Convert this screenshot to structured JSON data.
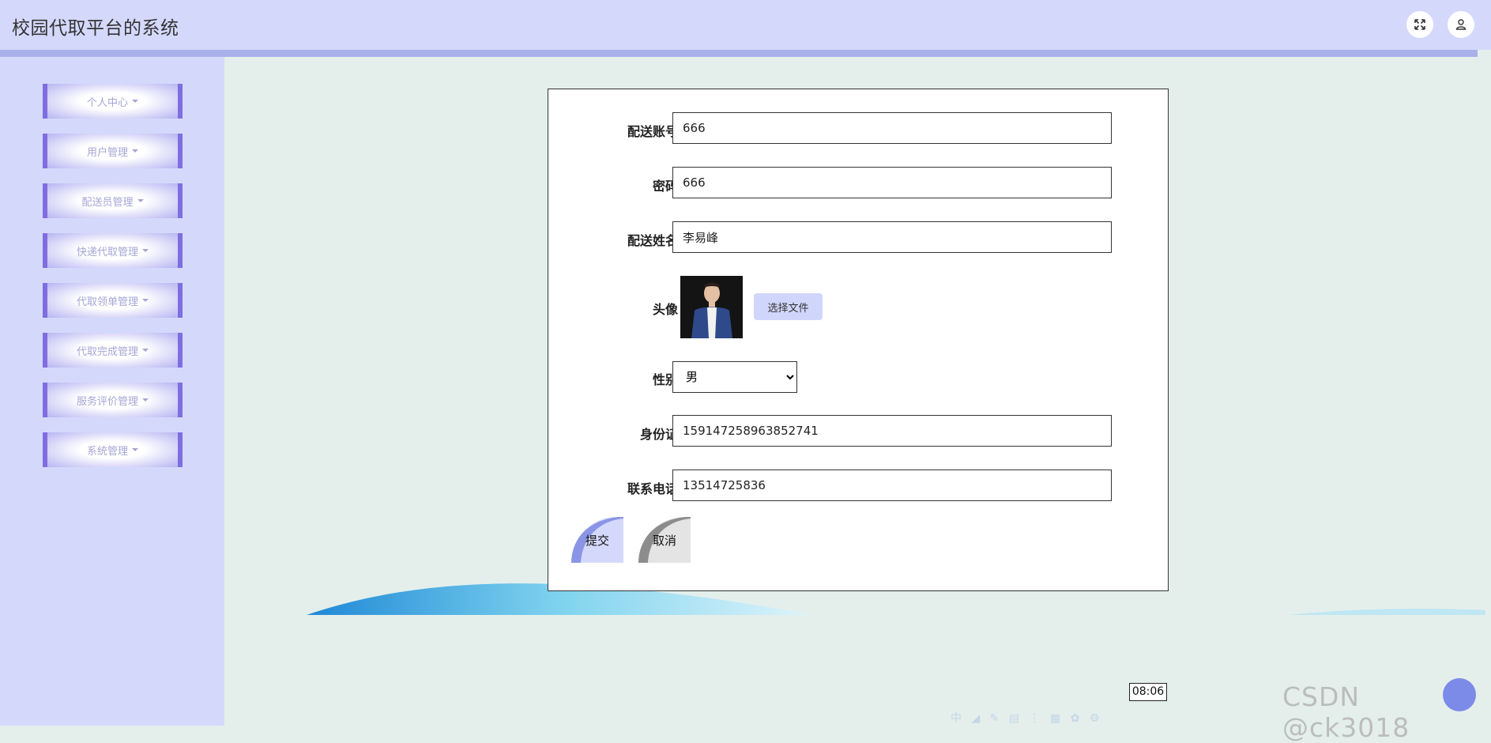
{
  "header": {
    "title": "校园代取平台的系统",
    "fullscreen_icon": "fullscreen-icon",
    "user_icon": "user-icon"
  },
  "sidebar": {
    "items": [
      {
        "label": "个人中心"
      },
      {
        "label": "用户管理"
      },
      {
        "label": "配送员管理"
      },
      {
        "label": "快递代取管理"
      },
      {
        "label": "代取领单管理"
      },
      {
        "label": "代取完成管理"
      },
      {
        "label": "服务评价管理"
      },
      {
        "label": "系统管理"
      }
    ]
  },
  "form": {
    "account_label": "配送账号",
    "account_value": "666",
    "password_label": "密码",
    "password_value": "666",
    "name_label": "配送姓名",
    "name_value": "李易峰",
    "avatar_label": "头像",
    "file_button": "选择文件",
    "gender_label": "性别",
    "gender_value": "男",
    "idcard_label": "身份证",
    "idcard_value": "159147258963852741",
    "phone_label": "联系电话",
    "phone_value": "13514725836",
    "submit_label": "提交",
    "cancel_label": "取消"
  },
  "taskbar": {
    "clock": "08:06",
    "ime_text": "中"
  },
  "watermark": "CSDN @ck3018",
  "colors": {
    "header_bg": "#d4d9fc",
    "accent": "#7f6ee0",
    "page_bg": "#e4efec"
  }
}
